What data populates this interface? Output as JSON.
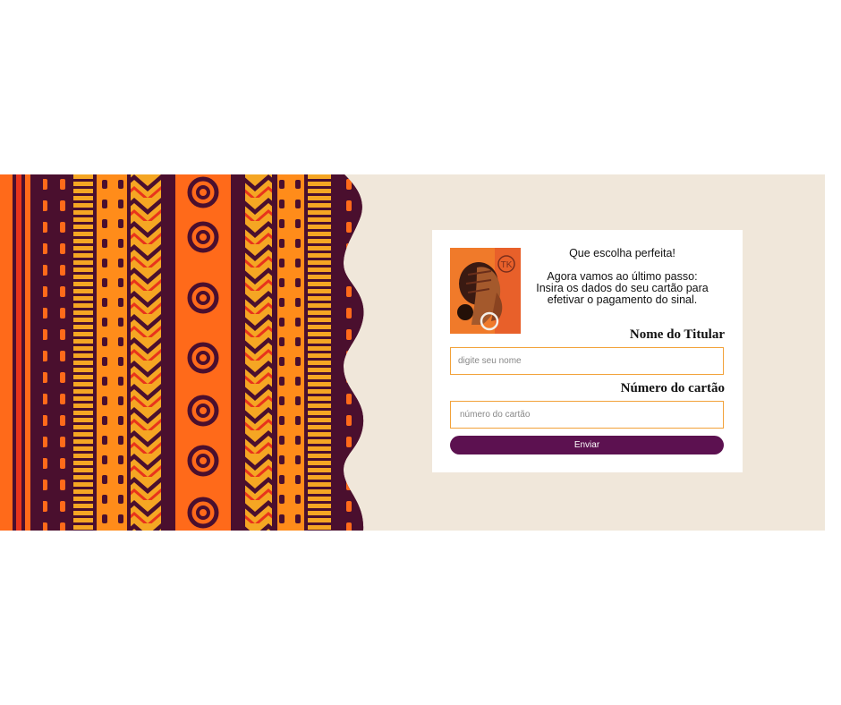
{
  "card": {
    "greeting": "Que escolha perfeita!",
    "instruction": "Agora vamos ao último passo: Insira os dados do seu cartão para efetivar o pagamento do sinal.",
    "portrait_icon": "woman-portrait-illustration-icon",
    "logo_text": "TK"
  },
  "form": {
    "name_label": "Nome do Titular",
    "name_placeholder": "digite seu nome",
    "name_value": "",
    "card_label": "Número do cartão",
    "card_placeholder": "número do cartão",
    "card_value": "",
    "submit_label": "Enviar"
  },
  "colors": {
    "banner_bg": "#f0e7da",
    "pattern_dark": "#4a0f2e",
    "pattern_orange": "#ff6a1a",
    "pattern_amber": "#f5a623",
    "pattern_red": "#e8341c",
    "input_border": "#f2a23a",
    "button_bg": "#5c1150"
  }
}
